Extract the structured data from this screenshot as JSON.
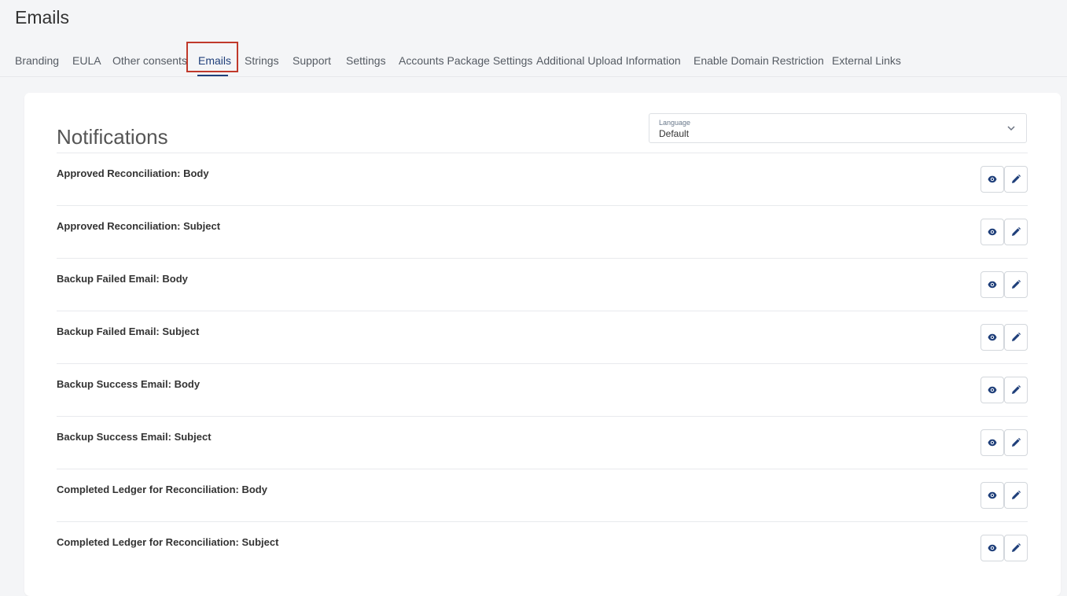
{
  "header": {
    "title": "Emails"
  },
  "tabs": [
    {
      "label": "Branding",
      "active": false
    },
    {
      "label": "EULA",
      "active": false
    },
    {
      "label": "Other consents",
      "active": false
    },
    {
      "label": "Emails",
      "active": true
    },
    {
      "label": "Strings",
      "active": false
    },
    {
      "label": "Support",
      "active": false
    },
    {
      "label": "Settings",
      "active": false
    },
    {
      "label": "Accounts Package Settings",
      "active": false
    },
    {
      "label": "Additional Upload Information",
      "active": false
    },
    {
      "label": "Enable Domain Restriction",
      "active": false
    },
    {
      "label": "External Links",
      "active": false
    }
  ],
  "notifications": {
    "title": "Notifications",
    "language": {
      "label": "Language",
      "value": "Default"
    },
    "items": [
      {
        "label": "Approved Reconciliation: Body"
      },
      {
        "label": "Approved Reconciliation: Subject"
      },
      {
        "label": "Backup Failed Email: Body"
      },
      {
        "label": "Backup Failed Email: Subject"
      },
      {
        "label": "Backup Success Email: Body"
      },
      {
        "label": "Backup Success Email: Subject"
      },
      {
        "label": "Completed Ledger for Reconciliation: Body"
      },
      {
        "label": "Completed Ledger for Reconciliation: Subject"
      }
    ]
  },
  "icons": {
    "view": "eye-icon",
    "edit": "pencil-icon",
    "dropdown": "chevron-down-icon"
  },
  "colors": {
    "accent": "#1f3f7a",
    "highlight": "#c0392b",
    "background": "#f4f5f7"
  }
}
